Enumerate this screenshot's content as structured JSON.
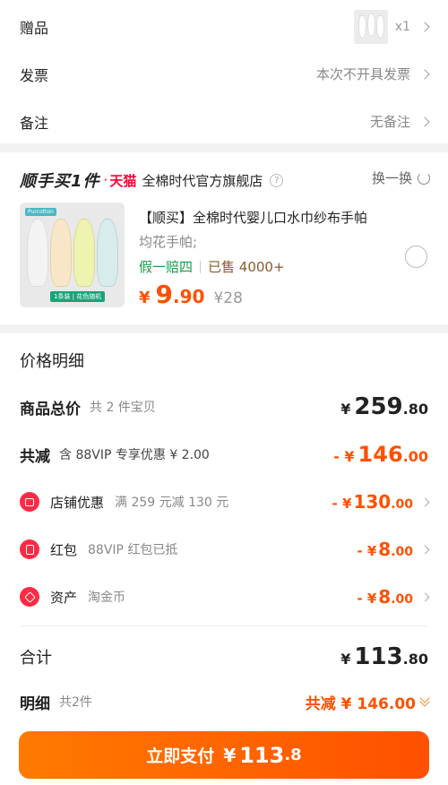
{
  "order": {
    "gift": {
      "label": "赠品",
      "qty": "x1"
    },
    "invoice": {
      "label": "发票",
      "value": "本次不开具发票"
    },
    "remark": {
      "label": "备注",
      "value": "无备注"
    }
  },
  "promo": {
    "brand": "顺手买1件",
    "platform": "天猫",
    "store": "全棉时代官方旗舰店",
    "help": "?",
    "swap_label": "换一换",
    "product": {
      "image_logo": "Purcotton",
      "image_tag": "1条装 | 花色随机",
      "title": "【顺买】全棉时代婴儿口水巾纱布手帕",
      "subtitle": "均花手帕;",
      "guarantee": "假一赔四",
      "sold": "已售 4000+",
      "price_symbol": "¥",
      "price_int": "9",
      "price_dec": ".90",
      "orig_price": "¥28"
    }
  },
  "price_detail": {
    "title": "价格明细",
    "subtotal": {
      "label": "商品总价",
      "desc": "共 2 件宝贝",
      "yen": "¥",
      "int": "259",
      "dec": ".80"
    },
    "discount": {
      "label": "共减",
      "desc": "含 88VIP 专享优惠 ¥ 2.00",
      "sign": "- ¥",
      "int": "146",
      "dec": ".00"
    },
    "store_discount": {
      "label": "店铺优惠",
      "desc": "满 259 元减 130 元",
      "sign": "- ¥",
      "int": "130",
      "dec": ".00"
    },
    "red_packet": {
      "label": "红包",
      "desc": "88VIP 红包已抵",
      "sign": "- ¥",
      "int": "8",
      "dec": ".00"
    },
    "assets": {
      "label": "资产",
      "desc": "淘金币",
      "sign": "- ¥",
      "int": "8",
      "dec": ".00"
    },
    "total": {
      "label": "合计",
      "yen": "¥",
      "int": "113",
      "dec": ".80"
    },
    "breakdown": {
      "label": "明细",
      "desc": "共2件",
      "value": "共减 ¥ 146.00"
    }
  },
  "pay_button": {
    "label": "立即支付",
    "yen": "¥",
    "int": "113",
    "dec": ".8"
  },
  "colors": {
    "accent": "#ff5000",
    "tmall": "#ff0036",
    "green": "#1a9b4b",
    "icon_red": "#ff2a44"
  },
  "icons": [
    "chevron-right-icon",
    "question-icon",
    "refresh-icon",
    "store-icon",
    "red-packet-icon",
    "coin-tag-icon",
    "double-chevron-down-icon"
  ]
}
